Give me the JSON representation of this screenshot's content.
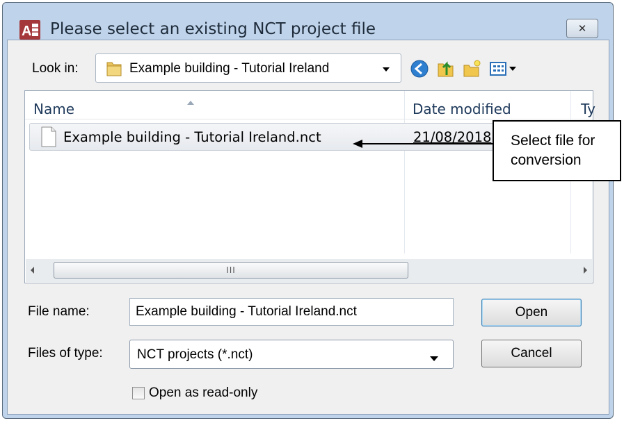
{
  "window": {
    "title": "Please select an existing NCT project file",
    "app_icon": "access-app-icon",
    "close_glyph": "✕"
  },
  "look_in": {
    "label": "Look in:",
    "value": "Example building - Tutorial Ireland",
    "icon": "folder-icon"
  },
  "toolbar": {
    "icons": [
      "back-icon",
      "up-folder-icon",
      "new-folder-icon",
      "view-menu-icon"
    ]
  },
  "file_list": {
    "columns": [
      "Name",
      "Date modified",
      "Ty"
    ],
    "rows": [
      {
        "name": "Example building - Tutorial Ireland.nct",
        "date": "21/08/2018"
      }
    ],
    "scroll_grip": "III"
  },
  "file_name": {
    "label": "File name:",
    "value": "Example building - Tutorial Ireland.nct"
  },
  "file_type": {
    "label": "Files of type:",
    "value": "NCT projects (*.nct)"
  },
  "buttons": {
    "open": "Open",
    "cancel": "Cancel"
  },
  "read_only": {
    "label": "Open as read-only",
    "checked": false
  },
  "annotation": {
    "text": "Select file for conversion"
  }
}
